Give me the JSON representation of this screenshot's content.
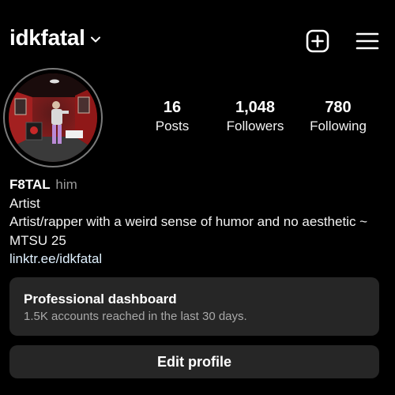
{
  "header": {
    "username": "idkfatal",
    "chevron_icon": "chevron-down-icon",
    "create_icon": "plus-square-icon",
    "menu_icon": "hamburger-menu-icon"
  },
  "profile": {
    "avatar_icon": "profile-photo",
    "stats": {
      "posts_count": "16",
      "posts_label": "Posts",
      "followers_count": "1,048",
      "followers_label": "Followers",
      "following_count": "780",
      "following_label": "Following"
    },
    "bio": {
      "name": "F8TAL",
      "pronouns": "him",
      "category": "Artist",
      "description": "Artist/rapper with a weird sense of humor and no aesthetic ~ MTSU 25",
      "link": "linktr.ee/idkfatal"
    }
  },
  "dashboard": {
    "title": "Professional dashboard",
    "subtitle": "1.5K accounts reached in the last 30 days."
  },
  "actions": {
    "edit_profile_label": "Edit profile"
  },
  "colors": {
    "background": "#000000",
    "card": "#262626",
    "text": "#f5f5f5",
    "muted": "#a8a8a8",
    "link": "#e0f1ff"
  }
}
